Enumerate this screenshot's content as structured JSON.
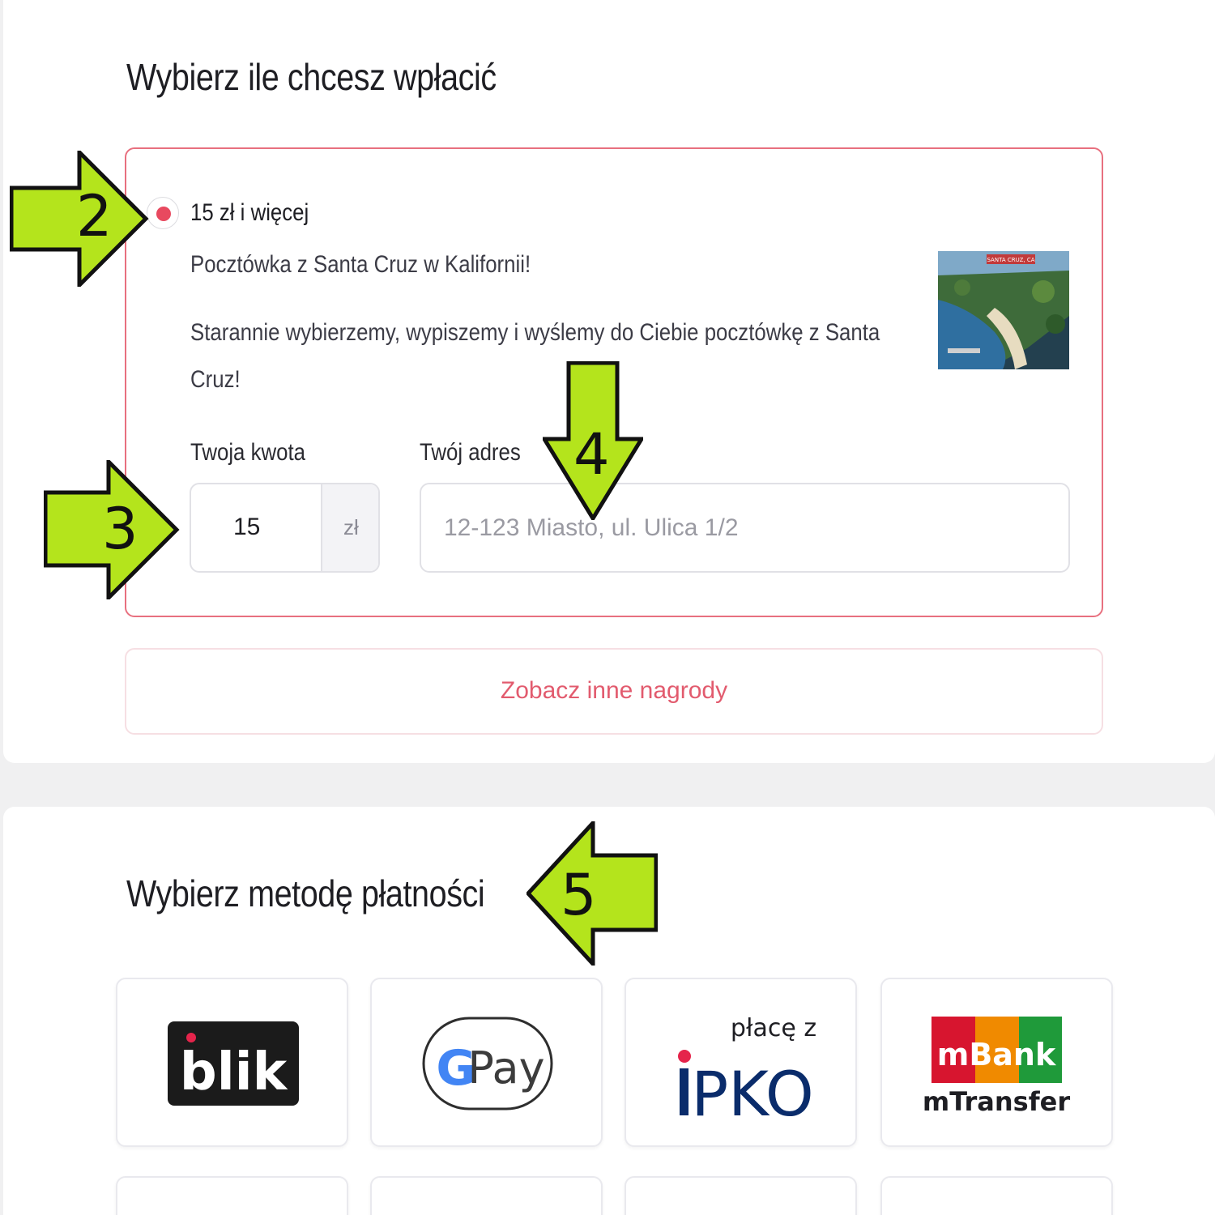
{
  "amount_section": {
    "heading": "Wybierz ile chcesz wpłacić",
    "reward": {
      "tier_label": "15 zł i więcej",
      "title": "Pocztówka z Santa Cruz w Kalifornii!",
      "description_line1": "Starannie wybierzemy, wypiszemy i wyślemy do Ciebie pocztówkę z Santa",
      "description_line2": "Cruz!",
      "image_caption": "SANTA CRUZ, CA"
    },
    "amount_field": {
      "label": "Twoja kwota",
      "value": "15",
      "unit": "zł"
    },
    "address_field": {
      "label": "Twój adres",
      "placeholder": "12-123 Miasto, ul. Ulica 1/2"
    },
    "other_rewards_button": "Zobacz inne nagrody"
  },
  "payment_section": {
    "heading": "Wybierz metodę płatności",
    "methods": [
      {
        "name": "blik",
        "logo_text": "blik"
      },
      {
        "name": "gpay",
        "logo_text_g": "G",
        "logo_text_pay": "Pay"
      },
      {
        "name": "ipko",
        "logo_top": "płacę z",
        "logo_main": "PKO",
        "logo_i": "i"
      },
      {
        "name": "mbank",
        "logo_top": "mBank",
        "logo_bottom": "mTransfer"
      }
    ]
  },
  "annotations": {
    "arrow_2": "2",
    "arrow_3": "3",
    "arrow_4": "4",
    "arrow_5": "5"
  },
  "colors": {
    "accent": "#e8495f",
    "accent_text": "#e25b6e",
    "arrow_fill": "#b4e41c",
    "mbank_red": "#d7152f",
    "mbank_orange": "#f08a00",
    "mbank_green": "#1f9a3a"
  },
  "icons": {
    "radio": "radio-selected-icon",
    "postcard": "postcard-image",
    "arrow": "annotation-arrow"
  }
}
